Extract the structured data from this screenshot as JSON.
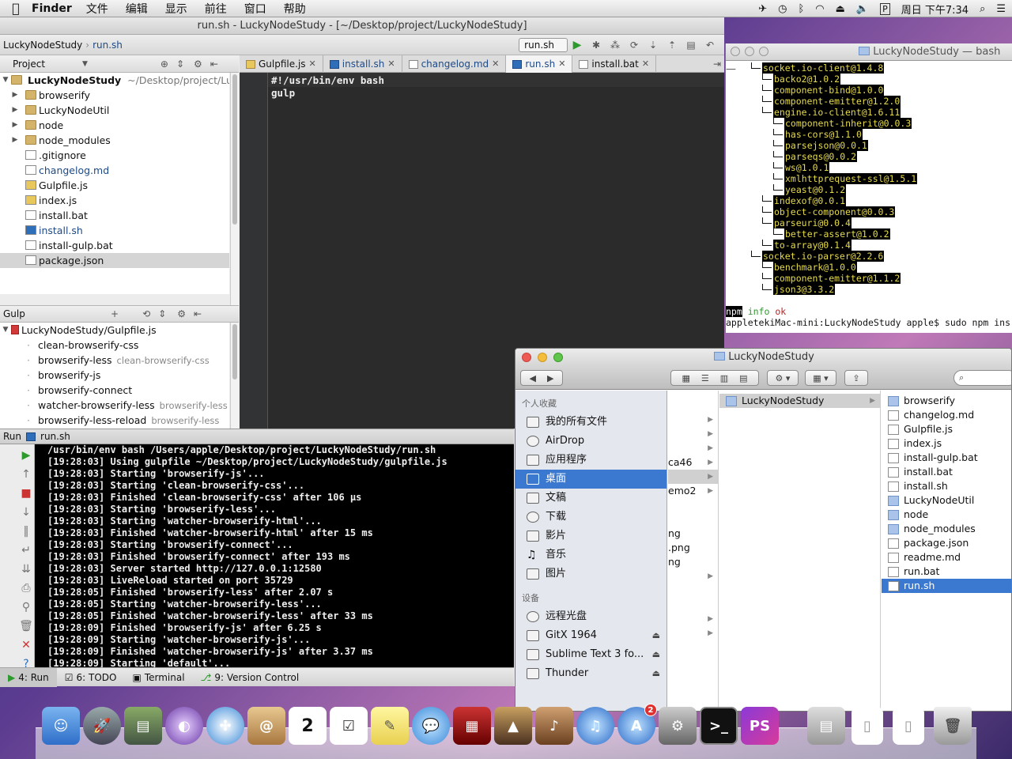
{
  "menubar": {
    "app": "Finder",
    "items": [
      "文件",
      "编辑",
      "显示",
      "前往",
      "窗口",
      "帮助"
    ],
    "clock": "周日 下午7:34"
  },
  "ide": {
    "title": "run.sh - LuckyNodeStudy - [~/Desktop/project/LuckyNodeStudy]",
    "breadcrumb": [
      "LuckyNodeStudy",
      "run.sh"
    ],
    "run_config": "run.sh",
    "project_label": "Project",
    "project_root": "LuckyNodeStudy",
    "project_path": "~/Desktop/project/LuckyNodeStudy",
    "files": [
      "browserify",
      "LuckyNodeUtil",
      "node",
      "node_modules",
      ".gitignore",
      "changelog.md",
      "Gulpfile.js",
      "index.js",
      "install.bat",
      "install.sh",
      "install-gulp.bat",
      "package.json"
    ],
    "gulp_label": "Gulp",
    "gulp_root": "LuckyNodeStudy/Gulpfile.js",
    "gulp_tasks": [
      {
        "name": "clean-browserify-css",
        "dep": ""
      },
      {
        "name": "browserify-less",
        "dep": "clean-browserify-css"
      },
      {
        "name": "browserify-js",
        "dep": ""
      },
      {
        "name": "browserify-connect",
        "dep": ""
      },
      {
        "name": "watcher-browserify-less",
        "dep": "browserify-less"
      },
      {
        "name": "browserify-less-reload",
        "dep": "browserify-less"
      }
    ],
    "tabs": [
      "Gulpfile.js",
      "install.sh",
      "changelog.md",
      "run.sh",
      "install.bat"
    ],
    "code": [
      "#!/usr/bin/env bash",
      "gulp"
    ],
    "run_label": "run.sh",
    "console": [
      "/usr/bin/env bash /Users/apple/Desktop/project/LuckyNodeStudy/run.sh",
      "[19:28:03] Using gulpfile ~/Desktop/project/LuckyNodeStudy/gulpfile.js",
      "[19:28:03] Starting 'browserify-js'...",
      "[19:28:03] Starting 'clean-browserify-css'...",
      "[19:28:03] Finished 'clean-browserify-css' after 106 μs",
      "[19:28:03] Starting 'browserify-less'...",
      "[19:28:03] Starting 'watcher-browserify-html'...",
      "[19:28:03] Finished 'watcher-browserify-html' after 15 ms",
      "[19:28:03] Starting 'browserify-connect'...",
      "[19:28:03] Finished 'browserify-connect' after 193 ms",
      "[19:28:03] Server started http://127.0.0.1:12580",
      "[19:28:03] LiveReload started on port 35729",
      "[19:28:05] Finished 'browserify-less' after 2.07 s",
      "[19:28:05] Starting 'watcher-browserify-less'...",
      "[19:28:05] Finished 'watcher-browserify-less' after 33 ms",
      "[19:28:09] Finished 'browserify-js' after 6.25 s",
      "[19:28:09] Starting 'watcher-browserify-js'...",
      "[19:28:09] Finished 'watcher-browserify-js' after 3.37 ms",
      "[19:28:09] Starting 'default'..."
    ],
    "bottom_tabs": [
      "4: Run",
      "6: TODO",
      "Terminal",
      "9: Version Control"
    ]
  },
  "terminal": {
    "title": "LuckyNodeStudy — bash —",
    "deps": [
      {
        "d": 0,
        "t": "socket.io-client@1.4.8"
      },
      {
        "d": 1,
        "t": "backo2@1.0.2"
      },
      {
        "d": 1,
        "t": "component-bind@1.0.0"
      },
      {
        "d": 1,
        "t": "component-emitter@1.2.0"
      },
      {
        "d": 1,
        "t": "engine.io-client@1.6.11"
      },
      {
        "d": 2,
        "t": "component-inherit@0.0.3"
      },
      {
        "d": 2,
        "t": "has-cors@1.1.0"
      },
      {
        "d": 2,
        "t": "parsejson@0.0.1"
      },
      {
        "d": 2,
        "t": "parseqs@0.0.2"
      },
      {
        "d": 2,
        "t": "ws@1.0.1"
      },
      {
        "d": 2,
        "t": "xmlhttprequest-ssl@1.5.1"
      },
      {
        "d": 2,
        "t": "yeast@0.1.2"
      },
      {
        "d": 1,
        "t": "indexof@0.0.1"
      },
      {
        "d": 1,
        "t": "object-component@0.0.3"
      },
      {
        "d": 1,
        "t": "parseuri@0.0.4"
      },
      {
        "d": 2,
        "t": "better-assert@1.0.2"
      },
      {
        "d": 1,
        "t": "to-array@0.1.4"
      },
      {
        "d": 0,
        "t": "socket.io-parser@2.2.6"
      },
      {
        "d": 1,
        "t": "benchmark@1.0.0"
      },
      {
        "d": 1,
        "t": "component-emitter@1.1.2"
      },
      {
        "d": 1,
        "t": "json3@3.3.2"
      }
    ],
    "npm": "npm",
    "info": "info",
    "ok": "ok",
    "prompt": "appletekiMac-mini:LuckyNodeStudy apple$ sudo npm ins"
  },
  "finder": {
    "title": "LuckyNodeStudy",
    "favorites_header": "个人收藏",
    "favorites": [
      "我的所有文件",
      "AirDrop",
      "应用程序",
      "桌面",
      "文稿",
      "下载",
      "影片",
      "音乐",
      "图片"
    ],
    "devices_header": "设备",
    "devices": [
      "远程光盘",
      "GitX 1964",
      "Sublime Text 3 fo...",
      "Thunder"
    ],
    "col1_fragments": [
      "ca46",
      "emo2",
      "ng",
      ".png",
      "ng"
    ],
    "col2": [
      "LuckyNodeStudy"
    ],
    "col3": [
      "browserify",
      "changelog.md",
      "Gulpfile.js",
      "index.js",
      "install-gulp.bat",
      "install.bat",
      "install.sh",
      "LuckyNodeUtil",
      "node",
      "node_modules",
      "package.json",
      "readme.md",
      "run.bat",
      "run.sh"
    ]
  },
  "dock": {
    "app_store_badge": "2",
    "calendar_day": "2",
    "phpstorm": "PS"
  }
}
